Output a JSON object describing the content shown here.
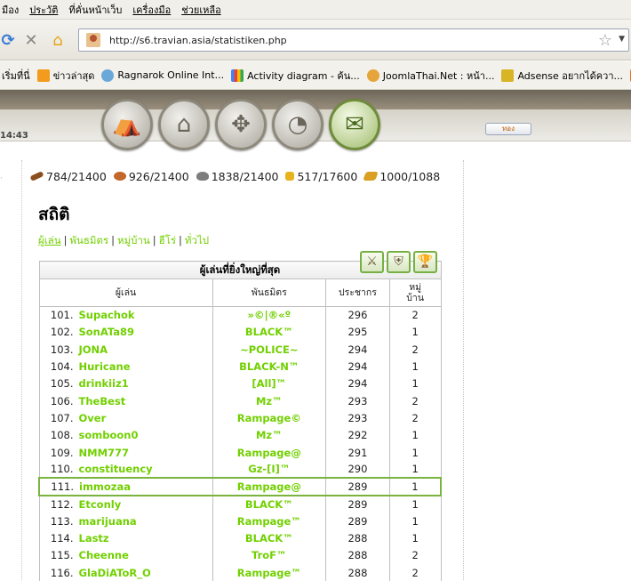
{
  "browser": {
    "menu": [
      "มือง",
      "ประวัติ",
      "ที่คั่นหน้าเว็บ",
      "เครื่องมือ",
      "ช่วยเหลือ"
    ],
    "url": "http://s6.travian.asia/statistiken.php",
    "bookmarks": [
      "เริ่มที่นี่",
      "ข่าวล่าสุด",
      "Ragnarok Online Int...",
      "Activity diagram - ค้น...",
      "JoomlaThai.Net : หน้า...",
      "Adsense อยากได้ควา...",
      "W"
    ]
  },
  "header": {
    "clock": "14:43",
    "gold_button": "ทอง",
    "nav_icons": [
      "village-overview-icon",
      "village-center-icon",
      "map-icon",
      "statistics-icon",
      "reports-icon"
    ]
  },
  "resources": {
    "wood": "784/21400",
    "clay": "926/21400",
    "iron": "1838/21400",
    "crop": "517/17600",
    "consumption": "1000/1088"
  },
  "page": {
    "title": "สถิติ",
    "tabs": [
      "ผู้เล่น",
      "พันธมิตร",
      "หมู่บ้าน",
      "ฮีโร่",
      "ทั่วไป"
    ]
  },
  "table": {
    "caption": "ผู้เล่นที่ยิ่งใหญ่ที่สุด",
    "headers": {
      "player": "ผู้เล่น",
      "alliance": "พันธมิตร",
      "population": "ประชากร",
      "villages_line1": "หมู่",
      "villages_line2": "บ้าน"
    },
    "rows": [
      {
        "rank": "101.",
        "player": "Supachok",
        "alliance": "»©|®«º",
        "pop": "296",
        "villages": "2"
      },
      {
        "rank": "102.",
        "player": "SonATa89",
        "alliance": "BLACK™",
        "pop": "295",
        "villages": "1"
      },
      {
        "rank": "103.",
        "player": "JONA",
        "alliance": "~POLICE~",
        "pop": "294",
        "villages": "2"
      },
      {
        "rank": "104.",
        "player": "Huricane",
        "alliance": "BLACK-N™",
        "pop": "294",
        "villages": "1"
      },
      {
        "rank": "105.",
        "player": "drinkiiz1",
        "alliance": "[All]™",
        "pop": "294",
        "villages": "1"
      },
      {
        "rank": "106.",
        "player": "TheBest",
        "alliance": "Mz™",
        "pop": "293",
        "villages": "2"
      },
      {
        "rank": "107.",
        "player": "Over",
        "alliance": "Rampage©",
        "pop": "293",
        "villages": "2"
      },
      {
        "rank": "108.",
        "player": "somboon0",
        "alliance": "Mz™",
        "pop": "292",
        "villages": "1"
      },
      {
        "rank": "109.",
        "player": "NMM777",
        "alliance": "Rampage@",
        "pop": "291",
        "villages": "1"
      },
      {
        "rank": "110.",
        "player": "constituency",
        "alliance": "Gz-[I]™",
        "pop": "290",
        "villages": "1"
      },
      {
        "rank": "111.",
        "player": "immozaa",
        "alliance": "Rampage@",
        "pop": "289",
        "villages": "1"
      },
      {
        "rank": "112.",
        "player": "Etconly",
        "alliance": "BLACK™",
        "pop": "289",
        "villages": "1"
      },
      {
        "rank": "113.",
        "player": "marijuana",
        "alliance": "Rampage™",
        "pop": "289",
        "villages": "1"
      },
      {
        "rank": "114.",
        "player": "Lastz",
        "alliance": "BLACK™",
        "pop": "288",
        "villages": "1"
      },
      {
        "rank": "115.",
        "player": "Cheenne",
        "alliance": "TroF™",
        "pop": "288",
        "villages": "2"
      },
      {
        "rank": "116.",
        "player": "GlaDiAToR_O",
        "alliance": "Rampage™",
        "pop": "288",
        "villages": "2"
      }
    ],
    "highlighted_row": 10
  }
}
